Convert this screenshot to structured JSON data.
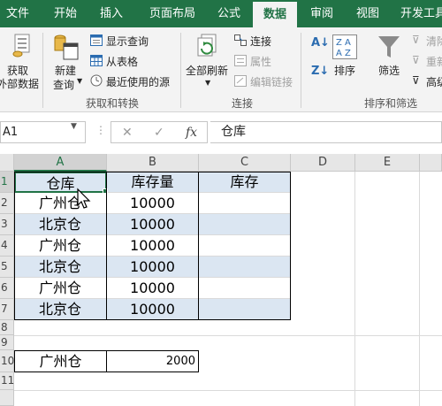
{
  "tabs": [
    "文件",
    "开始",
    "插入",
    "页面布局",
    "公式",
    "数据",
    "审阅",
    "视图",
    "开发工具"
  ],
  "active_tab": "数据",
  "ribbon": {
    "get_external_data": [
      "获取",
      "外部数据"
    ],
    "new_query": [
      "新建",
      "查询"
    ],
    "show_query": "显示查询",
    "from_table": "从表格",
    "recent_sources": "最近使用的源",
    "group_get_transform": "获取和转换",
    "refresh_all": "全部刷新",
    "connections": "连接",
    "properties": "属性",
    "edit_links": "编辑链接",
    "group_connections": "连接",
    "sort": "排序",
    "filter": "筛选",
    "clear": "清除",
    "reapply": "重新",
    "advanced": "高级",
    "group_sort_filter": "排序和筛选"
  },
  "formula_bar": {
    "name_box": "A1",
    "cancel": "✕",
    "enter": "✓",
    "fx": "fx",
    "formula": "仓库"
  },
  "columns": [
    "A",
    "B",
    "C",
    "D",
    "E"
  ],
  "rows": [
    "1",
    "2",
    "3",
    "4",
    "5",
    "6",
    "7",
    "8",
    "9",
    "10",
    "11"
  ],
  "table": {
    "headers": [
      "仓库",
      "库存量",
      "库存"
    ],
    "data": [
      [
        "广州仓",
        "10000",
        ""
      ],
      [
        "北京仓",
        "10000",
        ""
      ],
      [
        "广州仓",
        "10000",
        ""
      ],
      [
        "北京仓",
        "10000",
        ""
      ],
      [
        "广州仓",
        "10000",
        ""
      ],
      [
        "北京仓",
        "10000",
        ""
      ]
    ]
  },
  "criteria": {
    "a10": "广州仓",
    "b10": "2000"
  },
  "colors": {
    "excel_green": "#217346",
    "row_blue": "#dbe6f2",
    "ribbon_bg": "#f3f3f3"
  }
}
